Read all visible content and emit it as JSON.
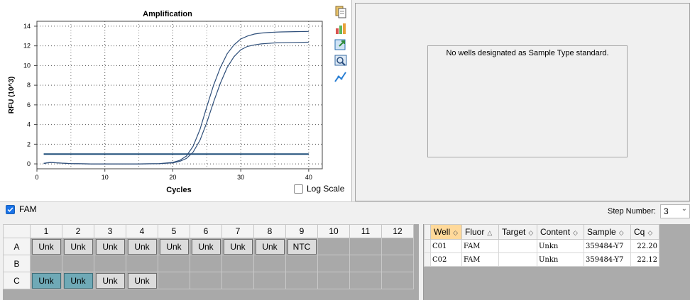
{
  "chart": {
    "title": "Amplification",
    "xlabel": "Cycles",
    "ylabel": "RFU (10^3)",
    "log_scale_label": "Log Scale"
  },
  "chart_data": {
    "type": "line",
    "title": "Amplification",
    "xlabel": "Cycles",
    "ylabel": "RFU (10^3)",
    "xlim": [
      0,
      42
    ],
    "ylim": [
      -0.5,
      14.5
    ],
    "xticks": [
      0,
      10,
      20,
      30,
      40
    ],
    "yticks": [
      0,
      2,
      4,
      6,
      8,
      10,
      12,
      14
    ],
    "grid": true,
    "threshold": 1.0,
    "series": [
      {
        "x": [
          1,
          2,
          3,
          5,
          8,
          10,
          12,
          15,
          18,
          20,
          21,
          22,
          23,
          24,
          25,
          26,
          27,
          28,
          29,
          30,
          31,
          32,
          33,
          34,
          35,
          36,
          38,
          40
        ],
        "y": [
          0.05,
          0.15,
          0.1,
          0.03,
          0.0,
          0.0,
          0.0,
          0.0,
          0.03,
          0.15,
          0.35,
          0.8,
          1.8,
          3.5,
          5.8,
          8.0,
          9.8,
          11.2,
          12.1,
          12.7,
          13.0,
          13.2,
          13.3,
          13.35,
          13.4,
          13.42,
          13.45,
          13.47
        ]
      },
      {
        "x": [
          1,
          2,
          3,
          5,
          8,
          10,
          12,
          15,
          18,
          20,
          21,
          22,
          23,
          24,
          25,
          26,
          27,
          28,
          29,
          30,
          31,
          32,
          33,
          34,
          35,
          36,
          38,
          40
        ],
        "y": [
          0.05,
          0.15,
          0.1,
          0.03,
          0.0,
          0.0,
          0.0,
          0.0,
          0.02,
          0.1,
          0.25,
          0.55,
          1.2,
          2.4,
          4.2,
          6.3,
          8.2,
          9.8,
          10.9,
          11.6,
          11.95,
          12.1,
          12.2,
          12.25,
          12.3,
          12.32,
          12.35,
          12.37
        ]
      }
    ],
    "colors": {
      "curves": "#2f4f7a",
      "threshold": "#1f4e79"
    }
  },
  "standard_panel": {
    "message": "No wells designated as Sample Type standard."
  },
  "fluor": {
    "label": "FAM",
    "checked": true
  },
  "step": {
    "label": "Step Number:",
    "value": "3"
  },
  "plate": {
    "columns": [
      "1",
      "2",
      "3",
      "4",
      "5",
      "6",
      "7",
      "8",
      "9",
      "10",
      "11",
      "12"
    ],
    "rows": [
      {
        "label": "A",
        "wells": [
          "Unk",
          "Unk",
          "Unk",
          "Unk",
          "Unk",
          "Unk",
          "Unk",
          "Unk",
          "NTC",
          "",
          "",
          ""
        ],
        "selected": []
      },
      {
        "label": "B",
        "wells": [
          "",
          "",
          "",
          "",
          "",
          "",
          "",
          "",
          "",
          "",
          "",
          ""
        ],
        "selected": []
      },
      {
        "label": "C",
        "wells": [
          "Unk",
          "Unk",
          "Unk",
          "Unk",
          "",
          "",
          "",
          "",
          "",
          "",
          "",
          ""
        ],
        "selected": [
          0,
          1
        ]
      }
    ]
  },
  "results": {
    "headers": [
      "Well",
      "Fluor",
      "Target",
      "Content",
      "Sample",
      "Cq"
    ],
    "sorted_column": 0,
    "rows": [
      [
        "C01",
        "FAM",
        "",
        "Unkn",
        "359484-Y7",
        "22.20"
      ],
      [
        "C02",
        "FAM",
        "",
        "Unkn",
        "359484-Y7",
        "22.12"
      ]
    ]
  },
  "icons": [
    "copy-icon",
    "export-chart-icon",
    "export-data-icon",
    "zoom-icon",
    "line-chart-icon"
  ]
}
